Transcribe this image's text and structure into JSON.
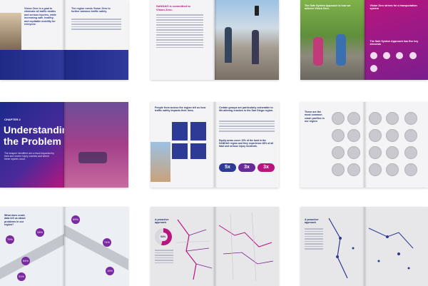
{
  "spreads": {
    "s1": {
      "intro_left": "Vision Zero is a goal to eliminate all traffic deaths and serious injuries, while increasing safe, healthy, and equitable mobility for everyone.",
      "intro_right": "The region needs Vision Zero to further advance traffic safety."
    },
    "s2": {
      "heading": "SANDAG is committed to Vision Zero."
    },
    "s3": {
      "heading": "The Safe System Approach is how we achieve Vision Zero.",
      "box_heading": "Vision Zero strives for a transportation system",
      "box_sub": "The Safe System Approach has five key elements"
    },
    "s4": {
      "chapter": "CHAPTER 2",
      "title_line1": "Understanding",
      "title_line2": "the Problem",
      "body": "The shapes' identified are a result impacted by their and severe injury crashes and where these injuries occur."
    },
    "s5": {
      "left_heading": "People from across the region tell us how traffic safety impacts their lives.",
      "right_heading": "Certain groups are particularly vulnerable to life-altering crashes in the San Diego region.",
      "right_body": "Equity areas cover 10% of the land in the SANDAG region and they experience 48% of all fatal and serious injury incidents.",
      "mult1": "5x",
      "mult2": "3x",
      "mult3": "3x"
    },
    "s6": {
      "heading": "These are the most common crash profiles in our region"
    },
    "s7": {
      "heading": "What does crash data tell us about problems in our region?",
      "pcts": [
        "79%",
        "54%",
        "59%",
        "74%",
        "28%",
        "31%",
        "15%"
      ]
    },
    "s8": {
      "heading": "A proactive approach",
      "stat": "54%"
    },
    "s9": {
      "heading": "A proactive approach"
    }
  }
}
